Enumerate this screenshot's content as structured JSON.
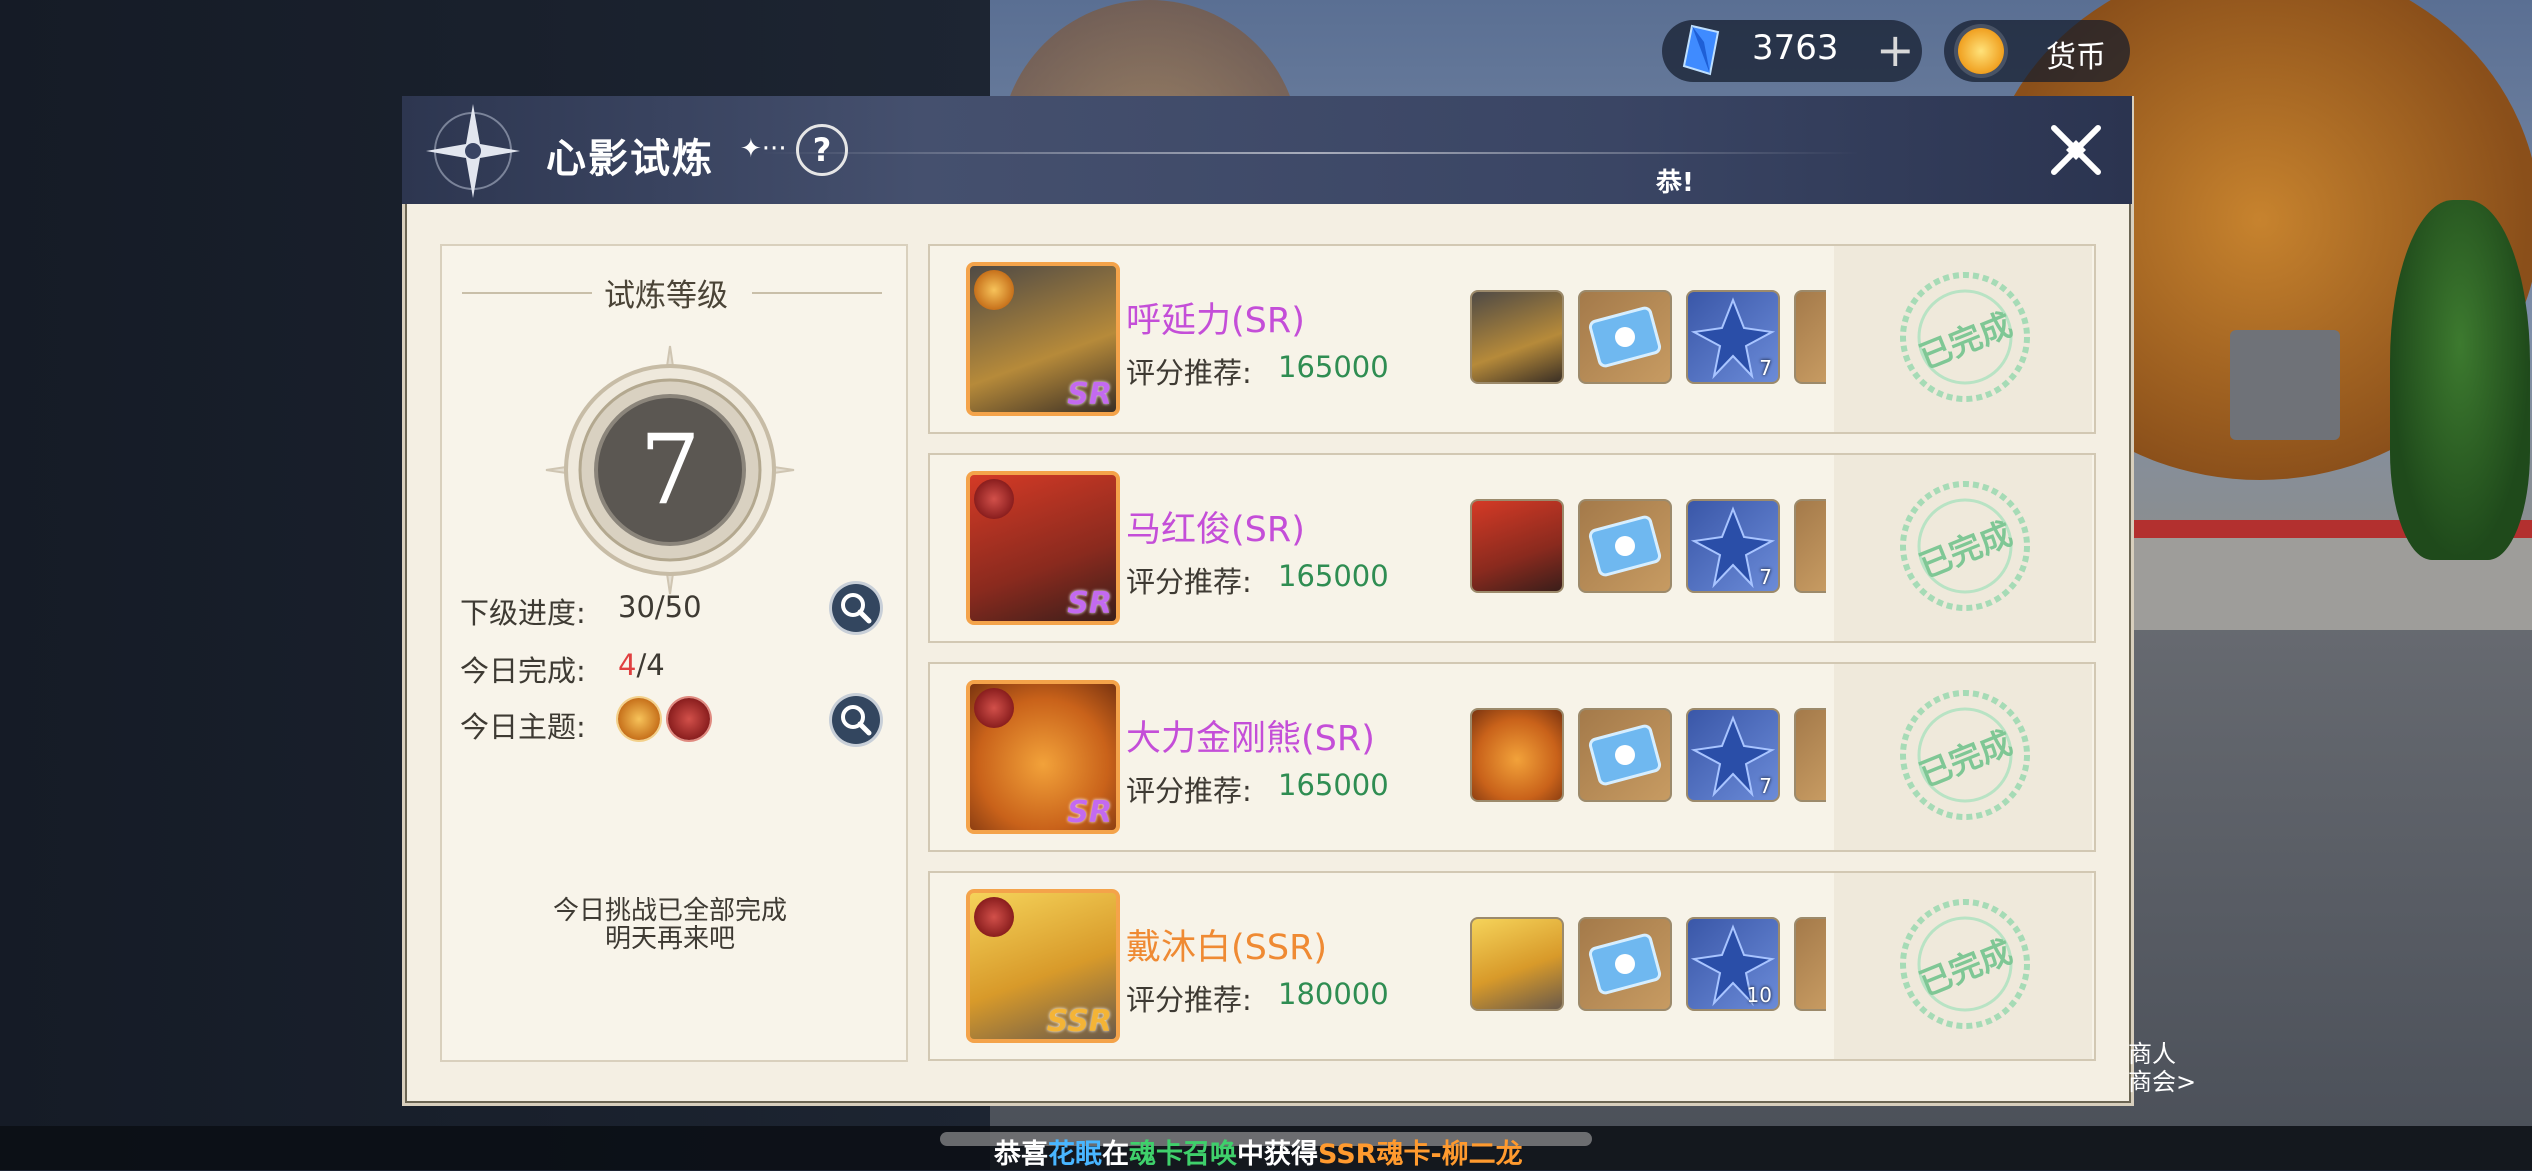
{
  "top_bar": {
    "gem_count": "3763",
    "plus_symbol": "+",
    "coin_label": "货币"
  },
  "header": {
    "title": "心影试炼",
    "deco": "✦···",
    "help_symbol": "?",
    "ticker_fragment": "恭!"
  },
  "left_panel": {
    "section_title": "试炼等级",
    "level": "7",
    "progress_label": "下级进度:",
    "progress_value": "30/50",
    "today_done_label": "今日完成:",
    "today_done_count": "4",
    "today_done_total": "/4",
    "theme_label": "今日主题:",
    "done_line1": "今日挑战已全部完成",
    "done_line2": "明天再来吧"
  },
  "challenges": [
    {
      "name": "呼延力(SR)",
      "rarity": "SR",
      "score_label": "评分推荐:",
      "score": "165000",
      "reward_star_count": "7",
      "status": "已完成"
    },
    {
      "name": "马红俊(SR)",
      "rarity": "SR",
      "score_label": "评分推荐:",
      "score": "165000",
      "reward_star_count": "7",
      "status": "已完成"
    },
    {
      "name": "大力金刚熊(SR)",
      "rarity": "SR",
      "score_label": "评分推荐:",
      "score": "165000",
      "reward_star_count": "7",
      "status": "已完成"
    },
    {
      "name": "戴沐白(SSR)",
      "rarity": "SSR",
      "score_label": "评分推荐:",
      "score": "180000",
      "reward_star_count": "10",
      "status": "已完成"
    }
  ],
  "bottom_ticker": {
    "p1": "恭喜",
    "player": "花眠",
    "p2": "在",
    "place": "魂卡召唤",
    "p3": "中获得",
    "prize": "SSR魂卡-柳二龙"
  },
  "merchant": {
    "line1": "商人",
    "line2": "商会>"
  },
  "colors": {
    "sr": "#c44ed8",
    "ssr": "#ef8a33",
    "score": "#2f8d52",
    "stamp": "#7fc795",
    "header": "#3a4564"
  }
}
